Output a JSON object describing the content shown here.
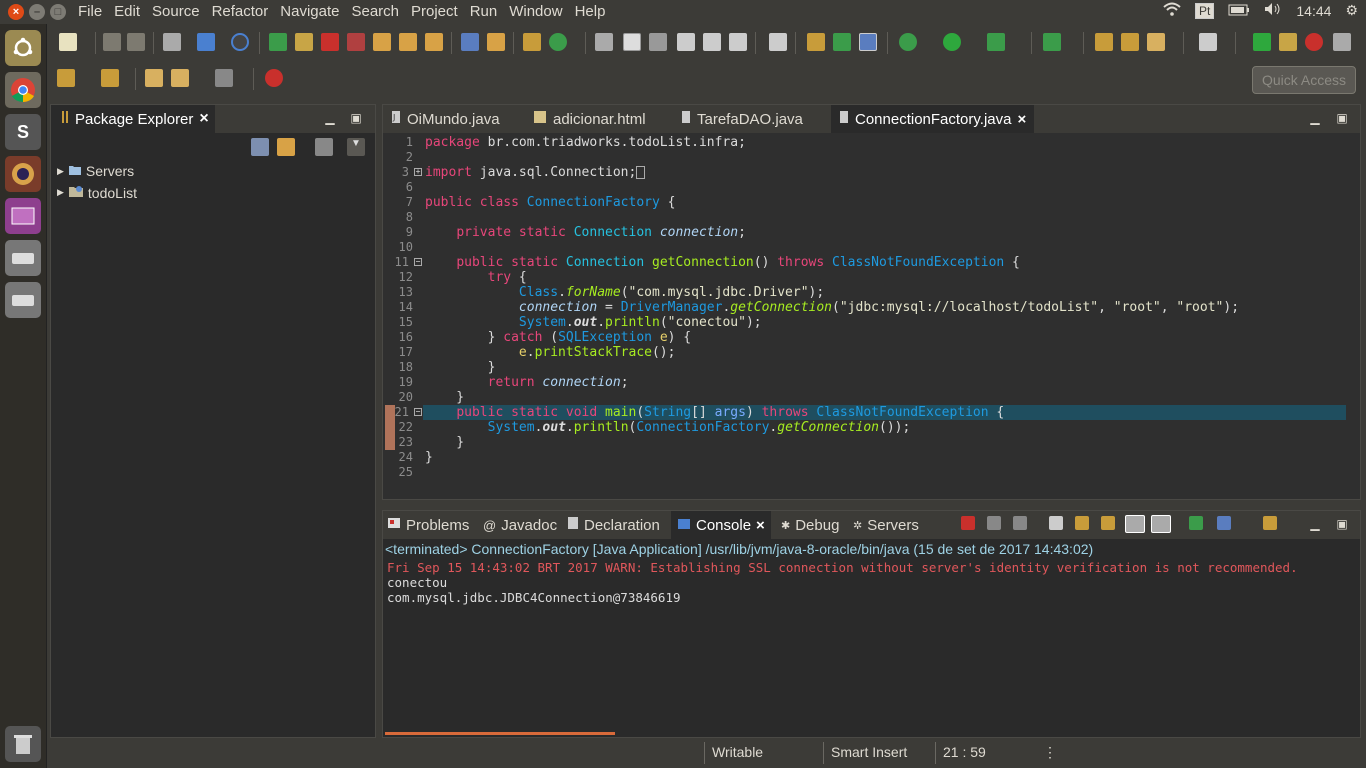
{
  "menubar": {
    "items": [
      "File",
      "Edit",
      "Source",
      "Refactor",
      "Navigate",
      "Search",
      "Project",
      "Run",
      "Window",
      "Help"
    ],
    "keyboard_layout": "Pt",
    "clock": "14:44"
  },
  "toolbar": {
    "quick_access_placeholder": "Quick Access"
  },
  "package_explorer": {
    "title": "Package Explorer",
    "items": [
      {
        "label": "Servers"
      },
      {
        "label": "todoList"
      }
    ]
  },
  "editor": {
    "tabs": [
      {
        "label": "OiMundo.java",
        "active": false
      },
      {
        "label": "adicionar.html",
        "active": false
      },
      {
        "label": "TarefaDAO.java",
        "active": false
      },
      {
        "label": "ConnectionFactory.java",
        "active": true
      }
    ],
    "line_numbers": [
      "1",
      "2",
      "3",
      "6",
      "7",
      "8",
      "9",
      "10",
      "11",
      "12",
      "13",
      "14",
      "15",
      "16",
      "17",
      "18",
      "19",
      "20",
      "21",
      "22",
      "23",
      "24",
      "25"
    ],
    "code": {
      "l1_kw": "package",
      "l1_rest": " br.com.triadworks.todoList.infra;",
      "l3_kw": "import",
      "l3_rest": " java.sql.Connection;",
      "l7_kw": "public class",
      "l7_cls": "ConnectionFactory",
      "l7_rest": " {",
      "l9_kw": "private static",
      "l9_ty": "Connection",
      "l9_fld": "connection",
      "l11_kw": "public static",
      "l11_ty": "Connection",
      "l11_meth": "getConnection",
      "l11_throws": "throws",
      "l11_exc": "ClassNotFoundException",
      "l12_kw": "try",
      "l13_cls": "Class",
      "l13_meth": "forName",
      "l13_str": "\"com.mysql.jdbc.Driver\"",
      "l14_fld": "connection",
      "l14_cls": "DriverManager",
      "l14_meth": "getConnection",
      "l14_str1": "\"jdbc:mysql://localhost/todoList\"",
      "l14_str2": "\"root\"",
      "l14_str3": "\"root\"",
      "l15_cls": "System",
      "l15_st": "out",
      "l15_meth": "println",
      "l15_str": "\"conectou\"",
      "l16_kw": "catch",
      "l16_exc": "SQLException",
      "l16_e": "e",
      "l17_e": "e",
      "l17_meth": "printStackTrace",
      "l19_kw": "return",
      "l19_fld": "connection",
      "l21_kw": "public static void",
      "l21_meth": "main",
      "l21_ty": "String",
      "l21_param": "args",
      "l21_throws": "throws",
      "l21_exc": "ClassNotFoundException",
      "l22_cls": "System",
      "l22_st": "out",
      "l22_meth": "println",
      "l22_cls2": "ConnectionFactory",
      "l22_meth2": "getConnection"
    }
  },
  "console_panel": {
    "tabs": [
      {
        "label": "Problems"
      },
      {
        "label": "Javadoc"
      },
      {
        "label": "Declaration"
      },
      {
        "label": "Console"
      },
      {
        "label": "Debug"
      },
      {
        "label": "Servers"
      }
    ],
    "header": "<terminated> ConnectionFactory [Java Application] /usr/lib/jvm/java-8-oracle/bin/java (15 de set de 2017 14:43:02)",
    "lines": [
      {
        "text": "Fri Sep 15 14:43:02 BRT 2017 WARN: Establishing SSL connection without server's identity verification is not recommended.",
        "color": "#e0575b"
      },
      {
        "text": "conectou",
        "color": "#dcdcdc"
      },
      {
        "text": "com.mysql.jdbc.JDBC4Connection@73846619",
        "color": "#dcdcdc"
      }
    ]
  },
  "statusbar": {
    "mode": "Writable",
    "insert": "Smart Insert",
    "position": "21 : 59"
  },
  "colors": {
    "accent": "#df4a16",
    "keyword": "#e7467a",
    "class": "#1e9ae0",
    "method": "#a7ec21",
    "string": "#e3e3ca"
  }
}
